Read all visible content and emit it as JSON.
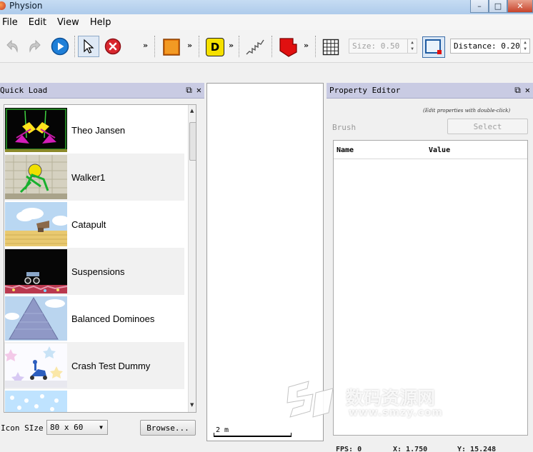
{
  "window": {
    "title": "Physion",
    "minimize_icon": "minimize-icon",
    "maximize_icon": "maximize-icon",
    "close_icon": "close-icon"
  },
  "menu": {
    "items": [
      "File",
      "Edit",
      "View",
      "Help"
    ]
  },
  "toolbar": {
    "buttons": [
      "undo-icon",
      "redo-icon",
      "play-icon",
      "select-pointer-icon",
      "delete-icon",
      "rectangle-icon",
      "distance-joint-icon",
      "spring-icon",
      "force-icon",
      "grid-icon",
      "snap-icon"
    ],
    "more_glyph": "»",
    "distance_joint_letter": "D",
    "size_label": "Size:",
    "size_value": "0.50",
    "distance_label": "Distance:",
    "distance_value": "0.20"
  },
  "quick_load": {
    "title": "Quick Load",
    "items": [
      {
        "label": "Theo Jansen",
        "thumb": "theo-jansen-thumb"
      },
      {
        "label": "Walker1",
        "thumb": "walker-thumb"
      },
      {
        "label": "Catapult",
        "thumb": "catapult-thumb"
      },
      {
        "label": "Suspensions",
        "thumb": "suspensions-thumb"
      },
      {
        "label": "Balanced Dominoes",
        "thumb": "dominoes-thumb"
      },
      {
        "label": "Crash Test Dummy",
        "thumb": "crash-thumb"
      }
    ],
    "icon_size_label": "Icon SIze",
    "icon_size_value": "80 x 60",
    "browse_label": "Browse..."
  },
  "canvas": {
    "scale_label": "2 m"
  },
  "property_editor": {
    "title": "Property Editor",
    "hint": "(Edit properties with double-click)",
    "brush_label": "Brush",
    "select_label": "Select",
    "columns": [
      "Name",
      "Value"
    ]
  },
  "status": {
    "fps": "FPS: 0",
    "x": "X: 1.750",
    "y": "Y: 15.248"
  },
  "watermark": {
    "main": "数码资源网",
    "sub": "www.smzy.com"
  },
  "colors": {
    "title_bar": "#aecbeb",
    "dock_header": "#c9cbe3",
    "accent_blue": "#1e7fd8",
    "rect_orange": "#e8780c",
    "joint_yellow": "#f5e000",
    "force_red": "#e01010"
  }
}
